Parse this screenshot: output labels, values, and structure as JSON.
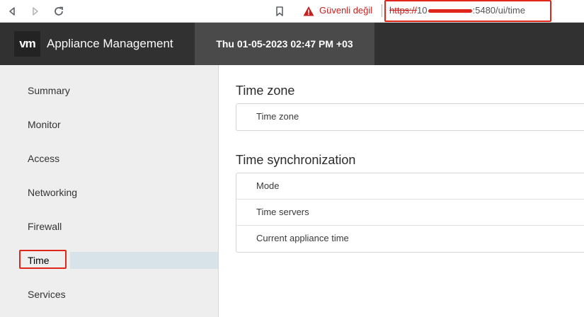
{
  "browser": {
    "security_warning": "Güvenli değil",
    "url_scheme": "https://",
    "url_prefix": "10",
    "url_suffix": ":5480/ui/time"
  },
  "header": {
    "logo": "vm",
    "title": "Appliance Management",
    "datetime": "Thu 01-05-2023 02:47 PM +03"
  },
  "sidebar": {
    "items": [
      {
        "label": "Summary"
      },
      {
        "label": "Monitor"
      },
      {
        "label": "Access"
      },
      {
        "label": "Networking"
      },
      {
        "label": "Firewall"
      },
      {
        "label": "Time"
      },
      {
        "label": "Services"
      }
    ],
    "active_index": 5
  },
  "main": {
    "timezone": {
      "title": "Time zone",
      "rows": [
        "Time zone"
      ]
    },
    "sync": {
      "title": "Time synchronization",
      "rows": [
        "Mode",
        "Time servers",
        "Current appliance time"
      ]
    }
  },
  "colors": {
    "header_bg": "#313131",
    "active_nav_bg": "#d8e3e9",
    "highlight_red": "#e0261b"
  }
}
